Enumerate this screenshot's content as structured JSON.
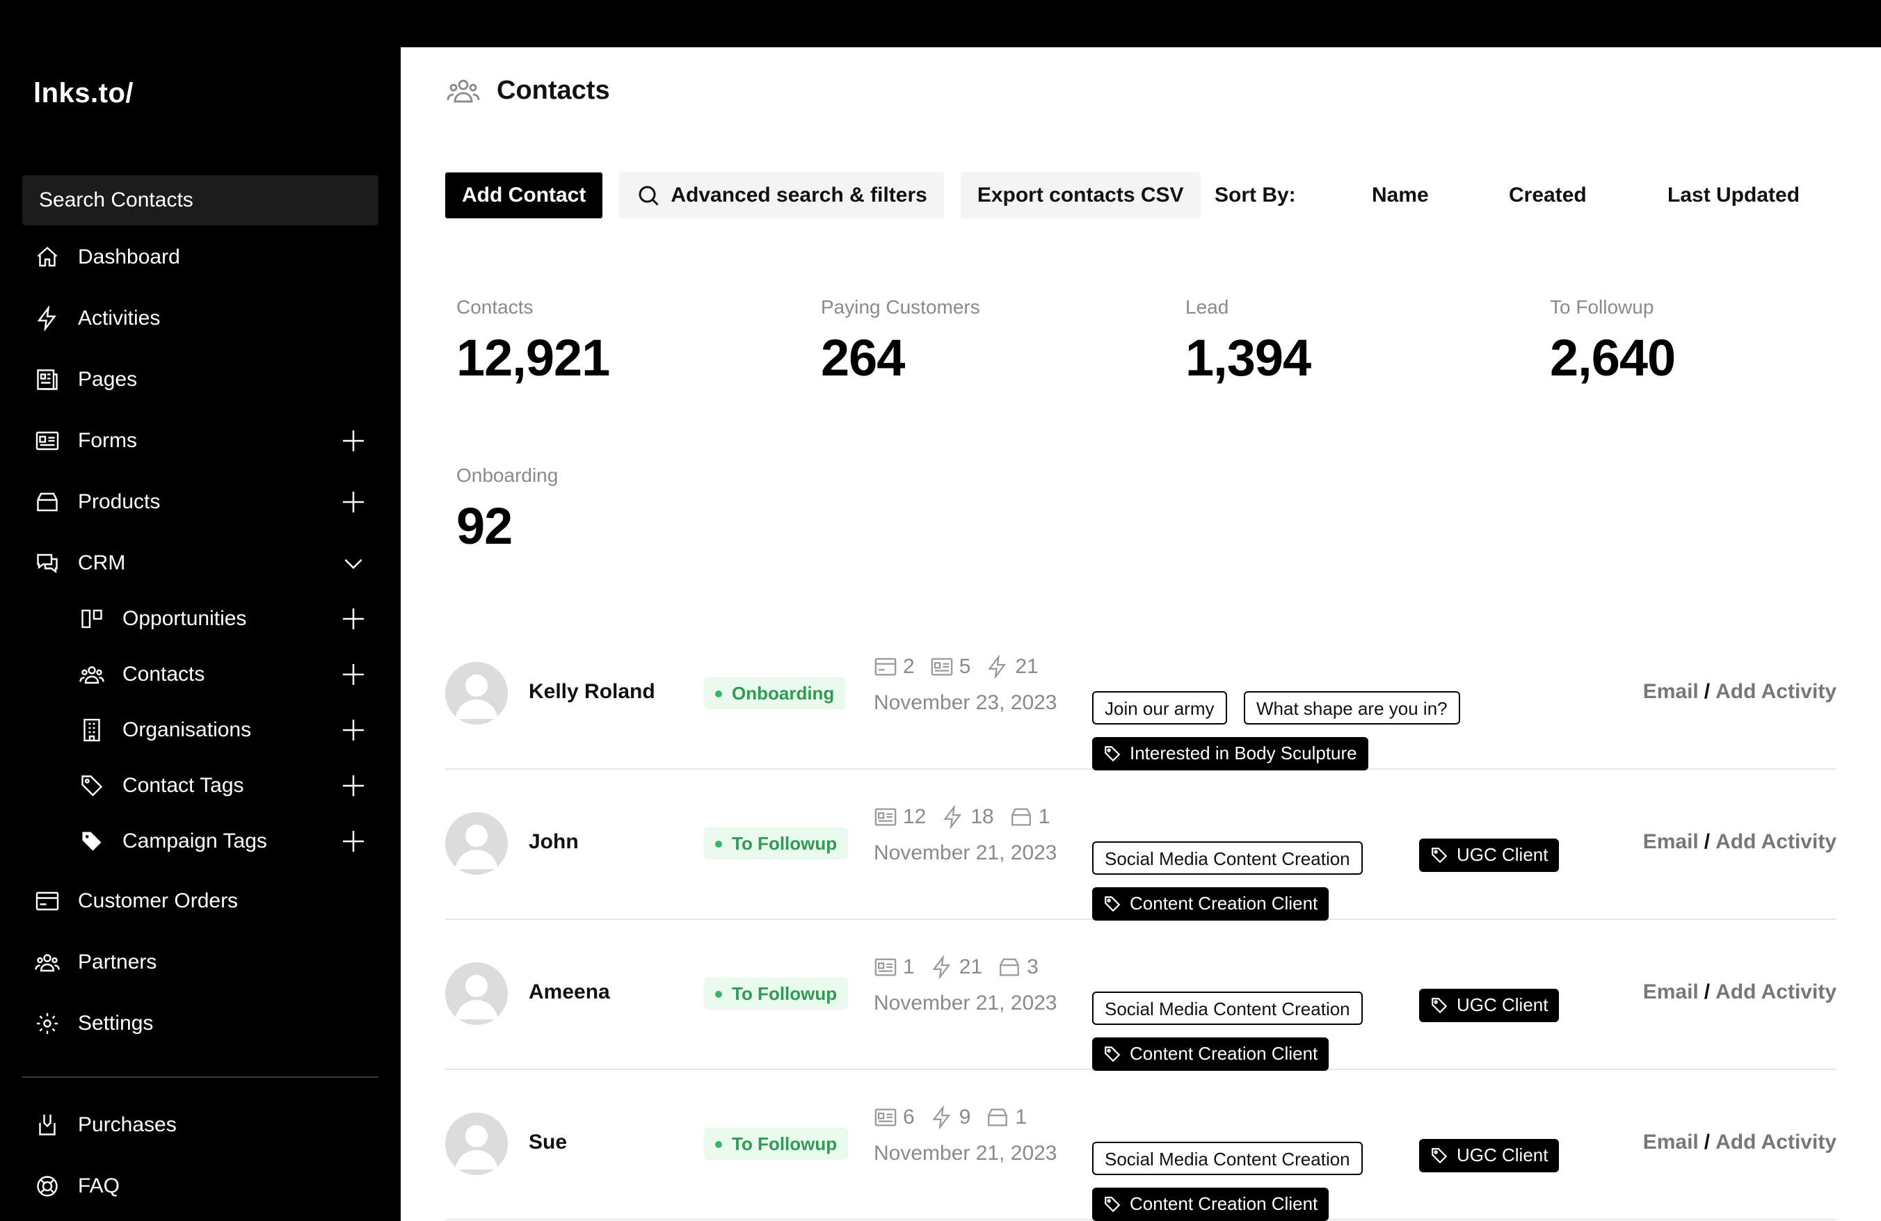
{
  "app": {
    "logo": "lnks.to/"
  },
  "sidebar": {
    "search_label": "Search Contacts",
    "items": [
      {
        "label": "Dashboard",
        "icon": "home-icon"
      },
      {
        "label": "Activities",
        "icon": "bolt-icon"
      },
      {
        "label": "Pages",
        "icon": "pages-icon"
      },
      {
        "label": "Forms",
        "icon": "form-icon"
      },
      {
        "label": "Products",
        "icon": "box-icon"
      },
      {
        "label": "CRM",
        "icon": "chat-icon"
      },
      {
        "label": "Opportunities",
        "icon": "kanban-icon"
      },
      {
        "label": "Contacts",
        "icon": "users-icon"
      },
      {
        "label": "Organisations",
        "icon": "building-icon"
      },
      {
        "label": "Contact Tags",
        "icon": "tag-icon"
      },
      {
        "label": "Campaign Tags",
        "icon": "tag-filled-icon"
      },
      {
        "label": "Customer Orders",
        "icon": "card-icon"
      },
      {
        "label": "Partners",
        "icon": "partners-icon"
      },
      {
        "label": "Settings",
        "icon": "gear-icon"
      },
      {
        "label": "Purchases",
        "icon": "purchase-icon"
      },
      {
        "label": "FAQ",
        "icon": "lifebuoy-icon"
      }
    ]
  },
  "header": {
    "title": "Contacts"
  },
  "toolbar": {
    "add_label": "Add Contact",
    "advanced_label": "Advanced search & filters",
    "export_label": "Export contacts CSV",
    "sort_label": "Sort By:",
    "sort_options": [
      "Name",
      "Created",
      "Last Updated"
    ]
  },
  "stats": [
    {
      "label": "Contacts",
      "value": "12,921"
    },
    {
      "label": "Paying Customers",
      "value": "264"
    },
    {
      "label": "Lead",
      "value": "1,394"
    },
    {
      "label": "To Followup",
      "value": "2,640"
    },
    {
      "label": "Onboarding",
      "value": "92"
    }
  ],
  "contacts": [
    {
      "name": "Kelly Roland",
      "status": "Onboarding",
      "counts": [
        {
          "icon": "card-icon",
          "value": "2"
        },
        {
          "icon": "form-icon",
          "value": "5"
        },
        {
          "icon": "bolt-icon",
          "value": "21"
        }
      ],
      "date": "November 23, 2023",
      "tags_outline": [
        "Join our army",
        "What shape are you in?"
      ],
      "tags_solid": [
        "Interested in Body Sculpture"
      ]
    },
    {
      "name": "John",
      "status": "To Followup",
      "counts": [
        {
          "icon": "form-icon",
          "value": "12"
        },
        {
          "icon": "bolt-icon",
          "value": "18"
        },
        {
          "icon": "box-icon",
          "value": "1"
        }
      ],
      "date": "November 21, 2023",
      "tags_outline": [
        "Social Media Content Creation"
      ],
      "tags_solid": [
        "UGC Client",
        "Content Creation Client"
      ]
    },
    {
      "name": "Ameena",
      "status": "To Followup",
      "counts": [
        {
          "icon": "form-icon",
          "value": "1"
        },
        {
          "icon": "bolt-icon",
          "value": "21"
        },
        {
          "icon": "box-icon",
          "value": "3"
        }
      ],
      "date": "November 21, 2023",
      "tags_outline": [
        "Social Media Content Creation"
      ],
      "tags_solid": [
        "UGC Client",
        "Content Creation Client"
      ]
    },
    {
      "name": "Sue",
      "status": "To Followup",
      "counts": [
        {
          "icon": "form-icon",
          "value": "6"
        },
        {
          "icon": "bolt-icon",
          "value": "9"
        },
        {
          "icon": "box-icon",
          "value": "1"
        }
      ],
      "date": "November 21, 2023",
      "tags_outline": [
        "Social Media Content Creation"
      ],
      "tags_solid": [
        "UGC Client",
        "Content Creation Client"
      ]
    }
  ],
  "row_actions": {
    "email": "Email",
    "separator": "/",
    "add_activity": "Add Activity"
  },
  "colors": {
    "status_bg": "#e9f9ee",
    "status_text": "#2f9b53",
    "accent": "#000000"
  }
}
